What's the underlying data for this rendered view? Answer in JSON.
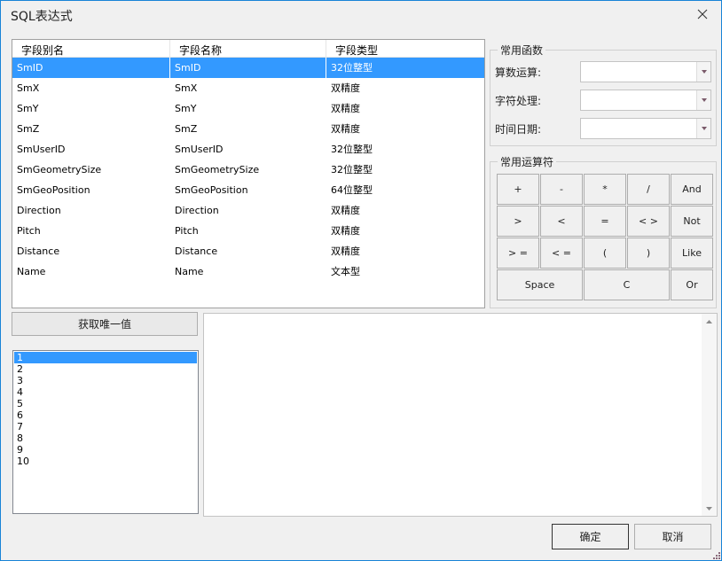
{
  "window": {
    "title": "SQL表达式",
    "close_icon": "close-icon"
  },
  "field_table": {
    "columns": [
      "字段别名",
      "字段名称",
      "字段类型"
    ],
    "selected_index": 0,
    "rows": [
      {
        "alias": "SmID",
        "name": "SmID",
        "type": "32位整型"
      },
      {
        "alias": "SmX",
        "name": "SmX",
        "type": "双精度"
      },
      {
        "alias": "SmY",
        "name": "SmY",
        "type": "双精度"
      },
      {
        "alias": "SmZ",
        "name": "SmZ",
        "type": "双精度"
      },
      {
        "alias": "SmUserID",
        "name": "SmUserID",
        "type": "32位整型"
      },
      {
        "alias": "SmGeometrySize",
        "name": "SmGeometrySize",
        "type": "32位整型"
      },
      {
        "alias": "SmGeoPosition",
        "name": "SmGeoPosition",
        "type": "64位整型"
      },
      {
        "alias": "Direction",
        "name": "Direction",
        "type": "双精度"
      },
      {
        "alias": "Pitch",
        "name": "Pitch",
        "type": "双精度"
      },
      {
        "alias": "Distance",
        "name": "Distance",
        "type": "双精度"
      },
      {
        "alias": "Name",
        "name": "Name",
        "type": "文本型"
      }
    ]
  },
  "functions": {
    "title": "常用函数",
    "rows": [
      {
        "label": "算数运算:",
        "value": ""
      },
      {
        "label": "字符处理:",
        "value": ""
      },
      {
        "label": "时间日期:",
        "value": ""
      }
    ]
  },
  "operators": {
    "title": "常用运算符",
    "buttons": [
      "+",
      "-",
      "*",
      "/",
      "And",
      ">",
      "<",
      "=",
      "< >",
      "Not",
      "> =",
      "< =",
      "(",
      ")",
      "Like",
      "Space",
      "C",
      "Or"
    ]
  },
  "unique": {
    "button_label": "获取唯一值",
    "selected_index": 0,
    "values": [
      "1",
      "2",
      "3",
      "4",
      "5",
      "6",
      "7",
      "8",
      "9",
      "10"
    ]
  },
  "expression": {
    "value": ""
  },
  "dialog_buttons": {
    "ok_label": "确定",
    "cancel_label": "取消"
  }
}
